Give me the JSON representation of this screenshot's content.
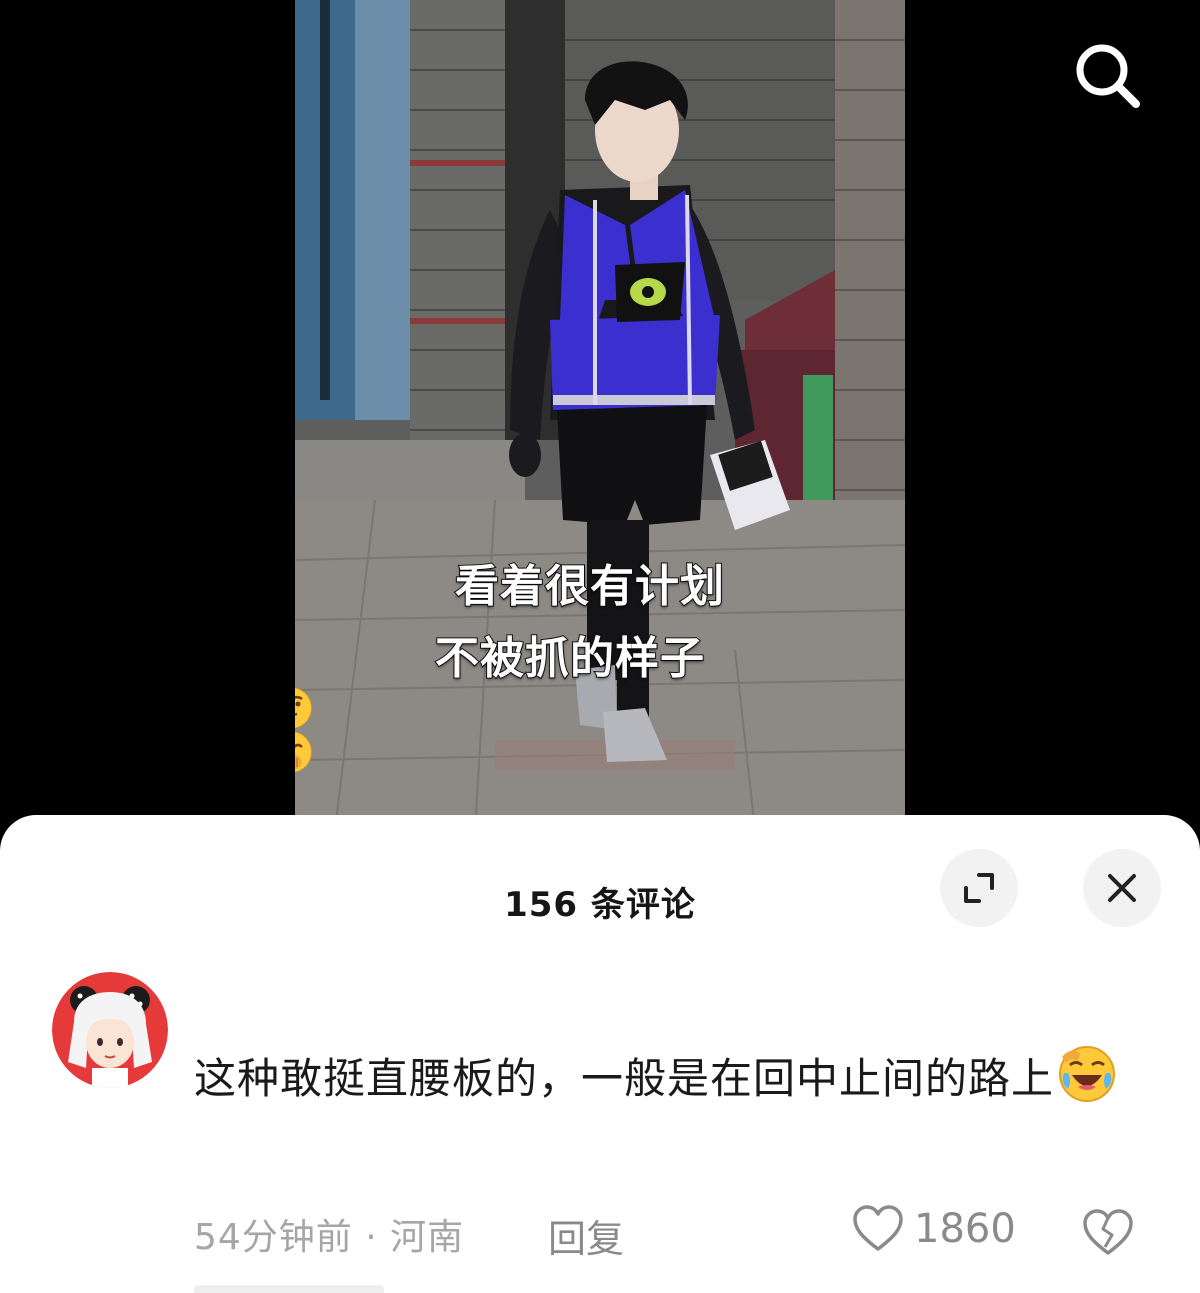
{
  "video": {
    "caption_line1": "看着很有计划",
    "caption_line2": "不被抓的样子"
  },
  "top_bar": {
    "search_icon": "search-icon"
  },
  "comments_sheet": {
    "title": "156 条评论",
    "expand_icon": "expand-icon",
    "close_icon": "close-icon"
  },
  "comment": {
    "text": "这种敢挺直腰板的，一般是在回中止间的路上",
    "time": "54分钟前",
    "separator": "·",
    "location": "河南",
    "reply_label": "回复",
    "like_count": "1860",
    "like_icon": "heart-icon",
    "dislike_icon": "broken-heart-icon"
  },
  "colors": {
    "sheet_bg": "#ffffff",
    "meta_text": "#a6a6a6",
    "vest": "#3b2fd0",
    "avatar_bg": "#e63a3a"
  }
}
